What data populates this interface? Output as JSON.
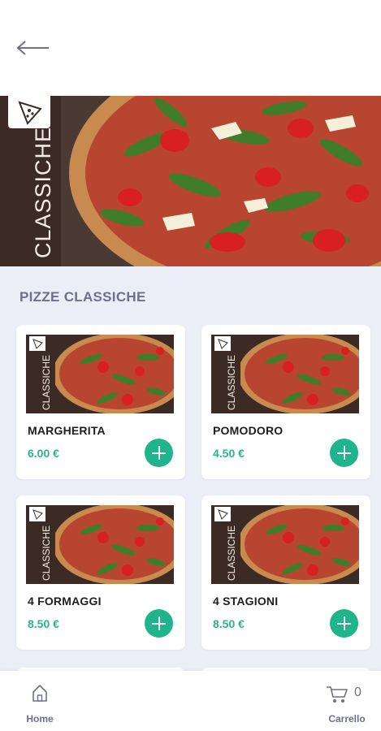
{
  "header": {
    "back_icon": "arrow-left-icon"
  },
  "hero": {
    "category_word": "CLASSICHE",
    "logo_icon": "pizza-slice-icon"
  },
  "section": {
    "title": "PIZZE CLASSICHE"
  },
  "products": [
    {
      "name": "MARGHERITA",
      "price": "6.00 €",
      "badge_word": "CLASSICHE"
    },
    {
      "name": "POMODORO",
      "price": "4.50 €",
      "badge_word": "CLASSICHE"
    },
    {
      "name": "4 FORMAGGI",
      "price": "8.50 €",
      "badge_word": "CLASSICHE"
    },
    {
      "name": "4 STAGIONI",
      "price": "8.50 €",
      "badge_word": "CLASSICHE"
    }
  ],
  "bottom_nav": {
    "home_label": "Home",
    "home_icon": "home-icon",
    "cart_label": "Carrello",
    "cart_icon": "cart-icon",
    "cart_count": "0"
  },
  "colors": {
    "accent": "#1fb48c",
    "price": "#2cb38c",
    "background": "#eceef7",
    "muted_text": "#6e7088"
  }
}
